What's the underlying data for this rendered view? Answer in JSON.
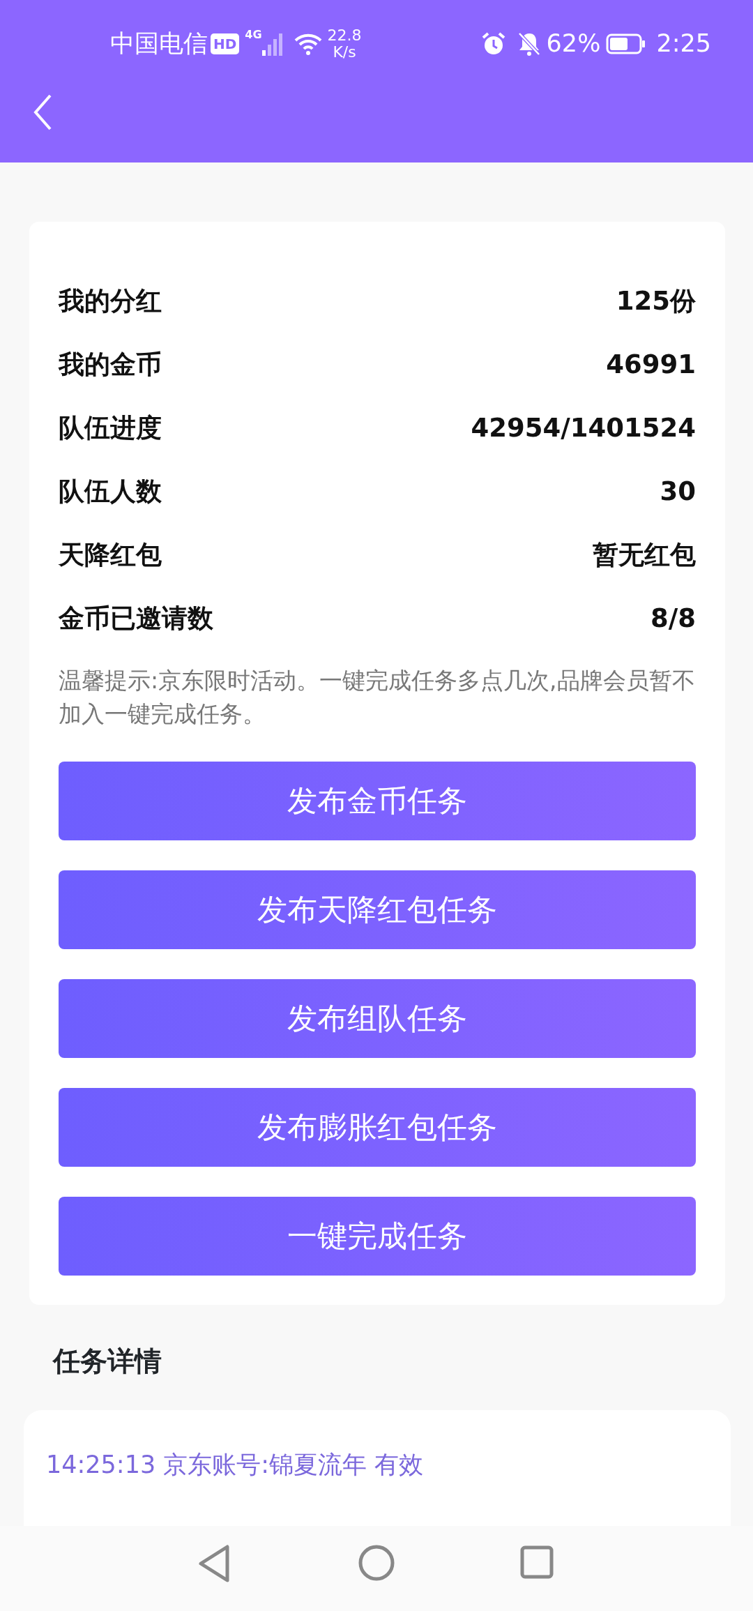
{
  "status_bar": {
    "carrier": "中国电信",
    "hd_badge": "HD",
    "network": "4G",
    "speed_value": "22.8",
    "speed_unit": "K/s",
    "battery_percent": "62%",
    "time": "2:25"
  },
  "stats": [
    {
      "label": "我的分红",
      "value": "125份"
    },
    {
      "label": "我的金币",
      "value": "46991"
    },
    {
      "label": "队伍进度",
      "value": "42954/1401524"
    },
    {
      "label": "队伍人数",
      "value": "30"
    },
    {
      "label": "天降红包",
      "value": "暂无红包"
    },
    {
      "label": "金币已邀请数",
      "value": "8/8"
    }
  ],
  "tip": "温馨提示:京东限时活动。一键完成任务多点几次,品牌会员暂不加入一键完成任务。",
  "buttons": [
    "发布金币任务",
    "发布天降红包任务",
    "发布组队任务",
    "发布膨胀红包任务",
    "一键完成任务"
  ],
  "details": {
    "title": "任务详情",
    "entries": [
      "14:25:13 京东账号:锦夏流年 有效"
    ]
  }
}
